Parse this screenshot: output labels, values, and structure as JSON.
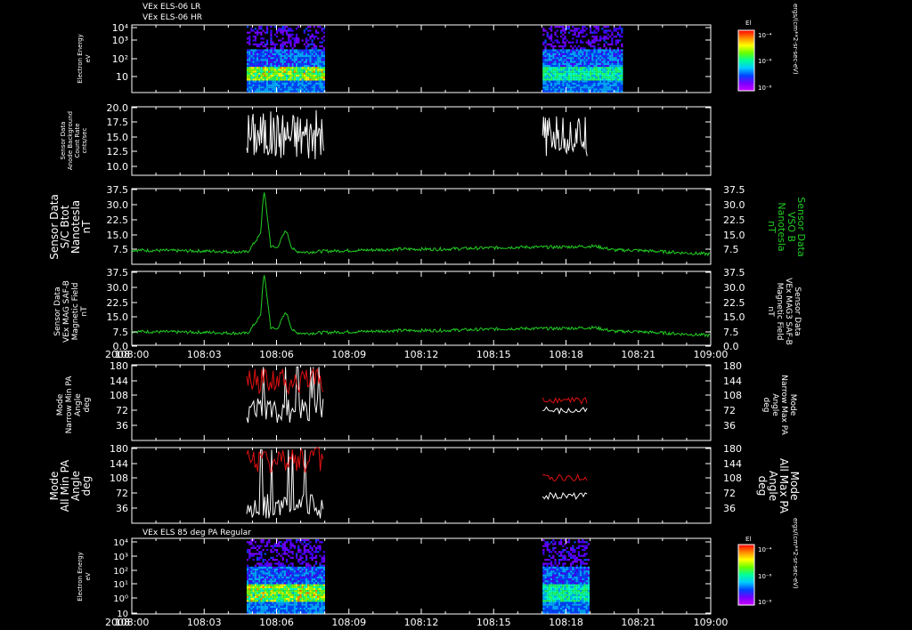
{
  "header": {
    "line1": "VEx ELS-06 LR",
    "line2": "VEx ELS-06 HR",
    "bottom_title": "VEx ELS 85 deg PA Regular"
  },
  "colors": {
    "white": "#ffffff",
    "green": "#22cc22",
    "red": "#dd1111",
    "frame": "#ffffff"
  },
  "colorbars": {
    "label": "El",
    "unit_label": "ergs/(cm**2-sr-sec-eV)",
    "ticks": [
      "10⁻⁴",
      "10⁻⁶",
      "10⁻⁸"
    ],
    "gradient": [
      "#ff0000",
      "#ff8800",
      "#ffff00",
      "#66ff00",
      "#00ff99",
      "#00ccff",
      "#0044ff",
      "#7700ff",
      "#cc00ff"
    ]
  },
  "time_axis": {
    "year": "2008",
    "ticks": [
      "108:00",
      "108:03",
      "108:06",
      "108:09",
      "108:12",
      "108:15",
      "108:18",
      "108:21",
      "109:00"
    ]
  },
  "panels": {
    "p1": {
      "ylabel": [
        "Electron Energy",
        "eV"
      ],
      "yticks": [
        "10⁴",
        "10³",
        "10²",
        "10"
      ]
    },
    "p2": {
      "ylabel": [
        "Sensor Data",
        "Anode Background",
        "Count Rate",
        "cnts/sec"
      ],
      "yticks": [
        "20.0",
        "17.5",
        "15.0",
        "12.5",
        "10.0"
      ]
    },
    "p3": {
      "ylabel": [
        "Sensor Data",
        "S/C Btot",
        "Nanotesla",
        "nT"
      ],
      "rlabel": [
        "Sensor Data",
        "VSO B",
        "Nanotesla",
        "nT"
      ],
      "yticks": [
        "37.5",
        "30.0",
        "22.5",
        "15.0",
        "7.5"
      ]
    },
    "p4": {
      "ylabel": [
        "Sensor Data",
        "VEx MAG SAF-B",
        "Magnetic Field",
        "nT"
      ],
      "rlabel": [
        "Sensor Data",
        "VEx MAG3 SAF-B",
        "Magnetic Field",
        "nT"
      ],
      "yticks": [
        "37.5",
        "30.0",
        "22.5",
        "15.0",
        "7.5",
        "0.0"
      ]
    },
    "p5": {
      "ylabel": [
        "Mode",
        "Narrow Min PA",
        "Angle",
        "deg"
      ],
      "rlabel": [
        "Mode",
        "Narrow Max PA",
        "Angle",
        "deg"
      ],
      "yticks": [
        "180",
        "144",
        "108",
        "72",
        "36"
      ]
    },
    "p6": {
      "ylabel": [
        "Mode",
        "All Min PA",
        "Angle",
        "deg"
      ],
      "rlabel": [
        "Mode",
        "All Max PA",
        "Angle",
        "deg"
      ],
      "yticks": [
        "180",
        "144",
        "108",
        "72",
        "36"
      ]
    },
    "p7": {
      "ylabel": [
        "Electron Energy",
        "eV"
      ],
      "yticks": [
        "10⁴",
        "10³",
        "10²",
        "10¹",
        "10⁰",
        "10"
      ]
    }
  },
  "chart_data": [
    {
      "type": "heatmap",
      "title": "VEx ELS-06 LR / VEx ELS-06 HR",
      "ylabel": "Electron Energy eV",
      "yscale": "log",
      "ylim": [
        3,
        10000
      ],
      "xlabel": "2008",
      "data_intervals_doy": [
        [
          108.0248,
          108.0415
        ],
        [
          108.0887,
          108.1059
        ]
      ],
      "colorbar": {
        "label": "El",
        "unit": "ergs/(cm**2-sr-sec-eV)",
        "range": [
          1e-08,
          0.0001
        ],
        "scale": "log"
      }
    },
    {
      "type": "line",
      "title": "Sensor Data Anode Background Count Rate",
      "ylabel": "cnts/sec",
      "ylim": [
        9,
        20
      ],
      "series": [
        {
          "name": "",
          "x_doy": [
            108.0248,
            108.0415
          ],
          "typical_range": [
            11.5,
            19.5
          ],
          "mean": 15.5
        },
        {
          "name": "",
          "x_doy": [
            108.0887,
            108.0985
          ],
          "typical_range": [
            12.0,
            18.5
          ],
          "mean": 15.0
        }
      ]
    },
    {
      "type": "line",
      "title": "Sensor Data S/C Btot",
      "ylabel": "nT",
      "ylim": [
        0,
        37.5
      ],
      "x": [
        108.0,
        108.0167,
        108.025,
        108.0278,
        108.0285,
        108.0292,
        108.03,
        108.0313,
        108.0333,
        108.0346,
        108.0354,
        108.0375,
        108.0417,
        108.05,
        108.0583,
        108.0667,
        108.075,
        108.0833,
        108.0917,
        108.1,
        108.1042,
        108.1083,
        108.1167,
        108.125
      ],
      "values": [
        7.0,
        6.5,
        6.0,
        15.0,
        37.0,
        25.0,
        9.0,
        8.0,
        17.0,
        8.0,
        6.5,
        6.0,
        6.5,
        7.0,
        7.5,
        7.5,
        8.0,
        8.5,
        8.5,
        9.0,
        7.0,
        7.0,
        6.0,
        5.0
      ],
      "color": "#22cc22"
    },
    {
      "type": "line",
      "title": "Sensor Data VEx MAG SAF-B Magnetic Field",
      "ylabel": "nT",
      "ylim": [
        0,
        37.5
      ],
      "x": [
        108.0,
        108.0167,
        108.025,
        108.0278,
        108.0285,
        108.0292,
        108.03,
        108.0313,
        108.0333,
        108.0346,
        108.0354,
        108.0375,
        108.0417,
        108.05,
        108.0583,
        108.0667,
        108.075,
        108.0833,
        108.0917,
        108.1,
        108.1042,
        108.1083,
        108.1167,
        108.125
      ],
      "values": [
        7.0,
        6.5,
        6.0,
        15.0,
        37.0,
        25.0,
        9.0,
        8.0,
        17.0,
        8.0,
        6.5,
        6.0,
        6.5,
        7.0,
        7.5,
        7.5,
        8.0,
        8.5,
        8.5,
        9.0,
        7.0,
        7.0,
        6.0,
        5.0
      ],
      "color": "#22cc22"
    },
    {
      "type": "line",
      "title": "Mode Narrow Min/Max PA Angle",
      "ylabel": "deg",
      "ylim": [
        0,
        180
      ],
      "series": [
        {
          "name": "",
          "color": "#ffffff",
          "x_doy": [
            [
              108.0248,
              108.0415
            ],
            [
              108.0887,
              108.0985
            ]
          ],
          "mean": [
            72,
            72
          ]
        },
        {
          "name": "",
          "color": "#dd1111",
          "x_doy": [
            [
              108.0248,
              108.0415
            ],
            [
              108.0887,
              108.0985
            ]
          ],
          "mean": [
            140,
            95
          ]
        }
      ]
    },
    {
      "type": "line",
      "title": "Mode All Min/Max PA Angle",
      "ylabel": "deg",
      "ylim": [
        0,
        180
      ],
      "series": [
        {
          "name": "",
          "color": "#ffffff",
          "x_doy": [
            [
              108.0248,
              108.0415
            ],
            [
              108.0887,
              108.0985
            ]
          ],
          "mean": [
            40,
            65
          ]
        },
        {
          "name": "",
          "color": "#dd1111",
          "x_doy": [
            [
              108.0248,
              108.0415
            ],
            [
              108.0887,
              108.0985
            ]
          ],
          "mean": [
            150,
            108
          ]
        }
      ]
    },
    {
      "type": "heatmap",
      "title": "VEx ELS 85 deg PA Regular",
      "ylabel": "Electron Energy eV",
      "yscale": "log",
      "ylim": [
        1,
        10000
      ],
      "xlabel": "2008",
      "data_intervals_doy": [
        [
          108.0248,
          108.0415
        ],
        [
          108.0887,
          108.0985
        ]
      ],
      "colorbar": {
        "label": "El",
        "unit": "ergs/(cm**2-sr-sec-eV)",
        "range": [
          1e-08,
          0.0001
        ],
        "scale": "log"
      }
    }
  ]
}
